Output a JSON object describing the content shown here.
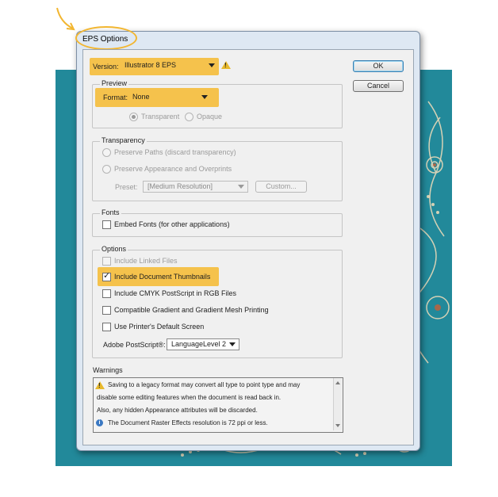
{
  "dialog": {
    "title": "EPS Options",
    "ok_label": "OK",
    "cancel_label": "Cancel"
  },
  "version": {
    "label": "Version:",
    "value": "Illustrator 8 EPS"
  },
  "preview": {
    "group_title": "Preview",
    "format_label": "Format:",
    "format_value": "None",
    "transparent_label": "Transparent",
    "opaque_label": "Opaque"
  },
  "transparency": {
    "group_title": "Transparency",
    "preserve_paths_label": "Preserve Paths (discard transparency)",
    "preserve_appearance_label": "Preserve Appearance and Overprints",
    "preset_label": "Preset:",
    "preset_value": "[Medium Resolution]",
    "custom_label": "Custom..."
  },
  "fonts": {
    "group_title": "Fonts",
    "embed_fonts_label": "Embed Fonts (for other applications)"
  },
  "options": {
    "group_title": "Options",
    "include_linked_label": "Include Linked Files",
    "include_thumbnails_label": "Include Document Thumbnails",
    "include_cmyk_label": "Include CMYK PostScript in RGB Files",
    "compatible_gradient_label": "Compatible Gradient and Gradient Mesh Printing",
    "printer_screen_label": "Use Printer's Default Screen",
    "postscript_label": "Adobe PostScript®:",
    "postscript_value": "LanguageLevel 2"
  },
  "warnings": {
    "title": "Warnings",
    "line1": "Saving to a legacy format may convert all type to point type and may",
    "line2": "disable some editing features when the document is read back in.",
    "line3": "Also, any hidden Appearance attributes will be discarded.",
    "line4": "The Document Raster Effects resolution is 72 ppi or less."
  },
  "colors": {
    "highlight": "#f5c24c",
    "artwork_teal": "#22899a",
    "dialog_frame": "#dee8f3"
  }
}
